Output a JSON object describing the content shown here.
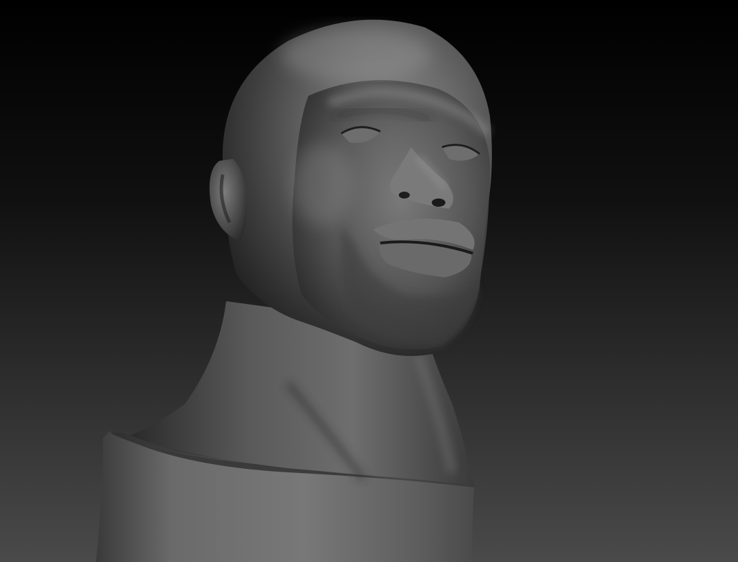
{
  "scene": {
    "subject": "sculpt-bust",
    "colors": {
      "background_top": "#000000",
      "background_bottom": "#4a4a4a",
      "clay_light": "#8a8a8a",
      "clay_mid": "#565656",
      "clay_dark": "#2b2b2b",
      "clay_shadow": "#161616"
    }
  }
}
